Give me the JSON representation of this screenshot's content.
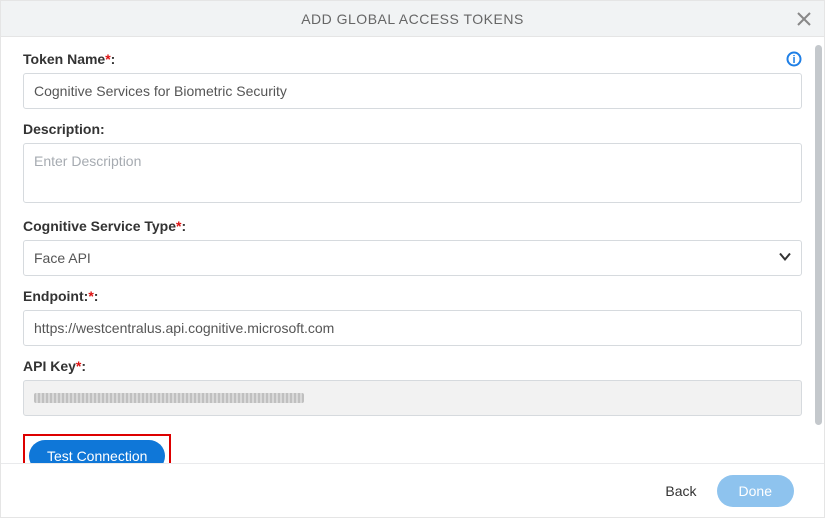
{
  "header": {
    "title": "ADD GLOBAL ACCESS TOKENS"
  },
  "fields": {
    "token_name": {
      "label": "Token Name",
      "value": "Cognitive Services for Biometric Security"
    },
    "description": {
      "label": "Description:",
      "placeholder": "Enter Description",
      "value": ""
    },
    "service_type": {
      "label": "Cognitive Service Type",
      "value": "Face API"
    },
    "endpoint": {
      "label": "Endpoint:",
      "value": "https://westcentralus.api.cognitive.microsoft.com"
    },
    "api_key": {
      "label": "API Key",
      "value": ""
    }
  },
  "buttons": {
    "test_connection": "Test Connection",
    "back": "Back",
    "done": "Done"
  },
  "required_marker": "*"
}
